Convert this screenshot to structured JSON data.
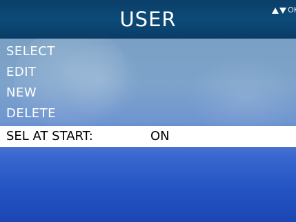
{
  "header": {
    "title": "USER",
    "nav_hint": {
      "up_icon": "triangle-up-icon",
      "down_icon": "triangle-down-icon",
      "ok_label": "OK"
    }
  },
  "menu": {
    "items": [
      {
        "label": "SELECT"
      },
      {
        "label": "EDIT"
      },
      {
        "label": "NEW"
      },
      {
        "label": "DELETE"
      }
    ]
  },
  "setting": {
    "label": "SEL AT START:",
    "value": "ON"
  },
  "colors": {
    "header_bg": "#0c4a78",
    "text": "#ffffff",
    "selected_row_bg": "#ffffff",
    "selected_row_text": "#000000"
  }
}
